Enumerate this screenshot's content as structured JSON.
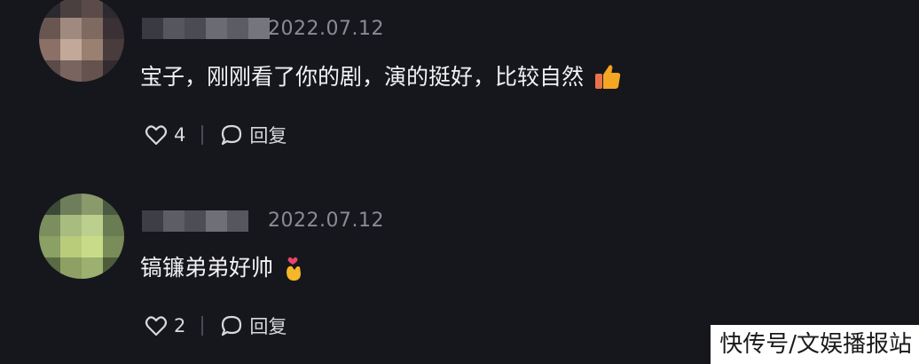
{
  "comments": [
    {
      "date": "2022.07.12",
      "text": "宝子，刚刚看了你的剧，演的挺好，比较自然",
      "emoji": "thumbs-up-icon",
      "like_count": "4",
      "reply_label": "回复"
    },
    {
      "date": "2022.07.12",
      "text": "镐镰弟弟好帅",
      "emoji": "finger-heart-icon",
      "like_count": "2",
      "reply_label": "回复"
    }
  ],
  "watermark": "快传号/文娱播报站",
  "colors": {
    "background": "#16171d",
    "date": "#8a8b93",
    "text": "#f2f2f4"
  }
}
